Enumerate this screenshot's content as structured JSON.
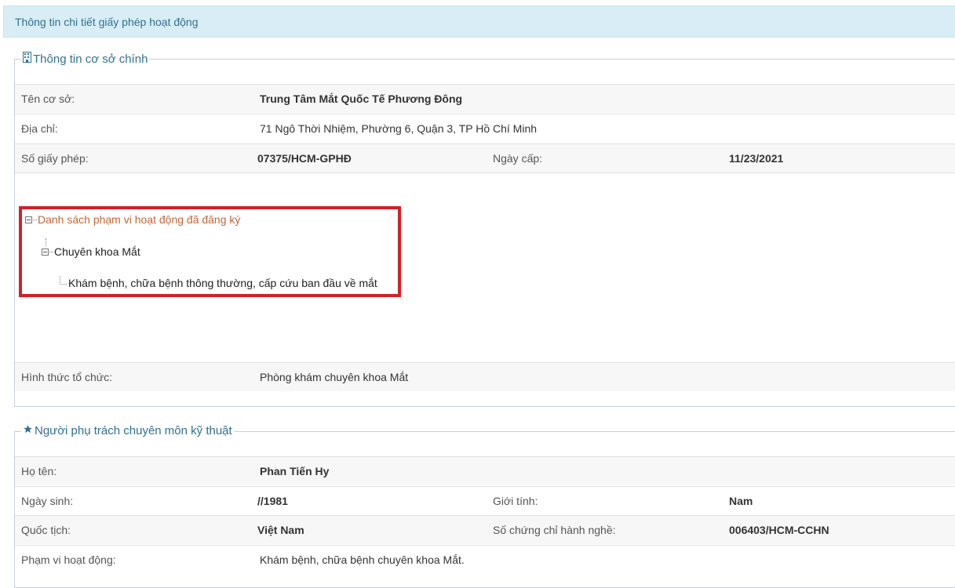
{
  "panel": {
    "title": "Thông tin chi tiết giấy phép hoạt động"
  },
  "facility": {
    "legend": "Thông tin cơ sở chính",
    "legend_icon": "building-icon",
    "name_label": "Tên cơ sở:",
    "name_value": "Trung Tâm Mắt Quốc Tế Phương Đông",
    "address_label": "Địa chỉ:",
    "address_value": "71 Ngô Thời Nhiệm, Phường 6, Quận 3, TP Hồ Chí Minh",
    "license_label": "Số giấy phép:",
    "license_value": "07375/HCM-GPHĐ",
    "issue_date_label": "Ngày cấp:",
    "issue_date_value": "11/23/2021",
    "tree": {
      "root": "Danh sách phạm vi hoạt động đã đăng ký",
      "child": "Chuyên khoa Mắt",
      "leaf": "Khám bệnh, chữa bệnh thông thường, cấp cứu ban đầu về mắt"
    },
    "org_form_label": "Hình thức tổ chức:",
    "org_form_value": "Phòng khám chuyên khoa Mắt"
  },
  "tech_person": {
    "legend": "Người phụ trách chuyên môn kỹ thuật",
    "legend_icon": "star-icon",
    "name_label": "Họ tên:",
    "name_value": "Phan Tiến Hy",
    "dob_label": "Ngày sinh:",
    "dob_value": "//1981",
    "gender_label": "Giới tính:",
    "gender_value": "Nam",
    "nationality_label": "Quốc tịch:",
    "nationality_value": "Việt Nam",
    "cert_label": "Số chứng chỉ hành nghề:",
    "cert_value": "006403/HCM-CCHN",
    "scope_label": "Phạm vi hoạt động:",
    "scope_value": "Khám bệnh, chữa bệnh chuyên khoa Mắt."
  },
  "colors": {
    "accent": "#31708f",
    "tree_root": "#c0663a",
    "highlight": "#d0212a"
  }
}
